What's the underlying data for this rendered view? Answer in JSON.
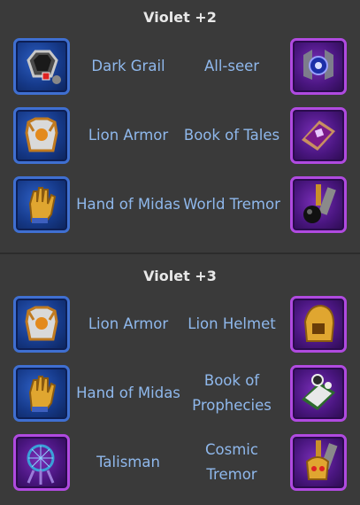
{
  "sections": [
    {
      "title": "Violet +2",
      "rows": [
        {
          "left": {
            "name": "Dark Grail",
            "icon": "dark-grail-icon"
          },
          "right": {
            "name": "All-seer",
            "icon": "all-seer-icon"
          }
        },
        {
          "left": {
            "name": "Lion Armor",
            "icon": "lion-armor-icon"
          },
          "right": {
            "name": "Book of Tales",
            "icon": "book-of-tales-icon"
          }
        },
        {
          "left": {
            "name": "Hand of Midas",
            "icon": "hand-of-midas-icon"
          },
          "right": {
            "name": "World Tremor",
            "icon": "world-tremor-icon"
          }
        }
      ]
    },
    {
      "title": "Violet +3",
      "rows": [
        {
          "left": {
            "name": "Lion Armor",
            "icon": "lion-armor-icon"
          },
          "right": {
            "name": "Lion Helmet",
            "icon": "lion-helmet-icon"
          }
        },
        {
          "left": {
            "name": "Hand of Midas",
            "icon": "hand-of-midas-icon"
          },
          "right": {
            "name": "Book of Prophecies",
            "icon": "book-of-prophecies-icon"
          }
        },
        {
          "left": {
            "name": "Talisman",
            "icon": "talisman-icon"
          },
          "right": {
            "name": "Cosmic Tremor",
            "icon": "cosmic-tremor-icon"
          }
        }
      ]
    }
  ],
  "colors": {
    "background": "#3a3a3a",
    "title": "#e8e8e8",
    "label": "#8fb8ec",
    "blue_frame": "#3f6fd1",
    "purple_frame": "#b04ae0"
  }
}
